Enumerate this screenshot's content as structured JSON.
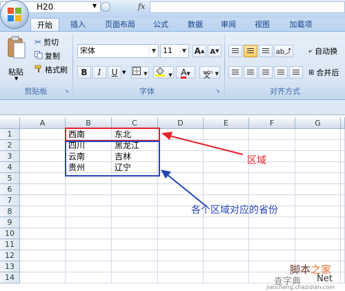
{
  "quick_access": {
    "save_icon": "save-icon",
    "undo_icon": "undo-icon",
    "redo_icon": "redo-icon"
  },
  "tabs": [
    {
      "label": "开始",
      "active": true
    },
    {
      "label": "插入"
    },
    {
      "label": "页面布局"
    },
    {
      "label": "公式"
    },
    {
      "label": "数据"
    },
    {
      "label": "审阅"
    },
    {
      "label": "视图"
    },
    {
      "label": "加载项"
    }
  ],
  "ribbon": {
    "clipboard": {
      "group_label": "剪贴板",
      "paste_label": "粘贴",
      "cut_label": "剪切",
      "copy_label": "复制",
      "format_painter_label": "格式刷"
    },
    "font": {
      "group_label": "字体",
      "font_name": "宋体",
      "font_size": "11",
      "grow_label": "A",
      "shrink_label": "A",
      "bold": "B",
      "italic": "I",
      "underline": "U",
      "font_color_letter": "A",
      "phonetic_label": "wén"
    },
    "alignment": {
      "group_label": "对齐方式",
      "wrap_text_label": "自动换",
      "merge_label": "合并后"
    }
  },
  "formula_bar": {
    "name_box": "H20",
    "fx_label": "fx",
    "formula": ""
  },
  "sheet": {
    "columns": [
      "A",
      "B",
      "C",
      "D",
      "E",
      "F",
      "G"
    ],
    "rows": [
      "1",
      "2",
      "3",
      "4",
      "5",
      "6",
      "7",
      "8",
      "9",
      "10",
      "11",
      "12",
      "13",
      "14"
    ],
    "cells": {
      "B1": "西南",
      "C1": "东北",
      "B2": "四川",
      "C2": "黑龙江",
      "B3": "云南",
      "C3": "吉林",
      "B4": "贵州",
      "C4": "辽宁"
    }
  },
  "annotations": {
    "region_label": "区域",
    "province_label": "各个区域对应的省份",
    "region_color": "#e8202a",
    "province_color": "#2646b8"
  },
  "watermark": {
    "line1_a": "脚本",
    "line1_b": "之家",
    "line2": "查字典",
    "line3": "jiaocheng.chazidian.com",
    "net_label": "Net"
  }
}
